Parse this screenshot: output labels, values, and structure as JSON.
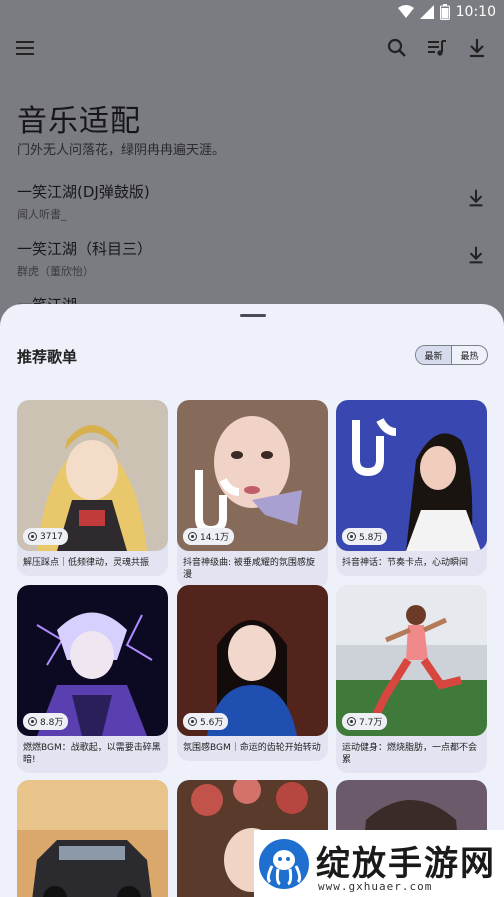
{
  "status_bar": {
    "time": "10:10",
    "battery": "87"
  },
  "page": {
    "title": "音乐适配",
    "subtitle": "门外无人问落花，绿阴冉冉遍天涯。"
  },
  "songs": [
    {
      "title": "一笑江湖(DJ弹鼓版)",
      "artist": "闻人听書_"
    },
    {
      "title": "一笑江湖（科目三）",
      "artist": "群虎（董欣怡）"
    },
    {
      "title": "一笑江湖",
      "artist": ""
    }
  ],
  "sheet": {
    "title": "推荐歌单",
    "toggle": [
      "最新",
      "最热"
    ],
    "cards": [
      {
        "plays": "3717",
        "caption": "解压踩点｜低频律动，灵魂共振"
      },
      {
        "plays": "14.1万",
        "caption": "抖音神级曲: 被垂咸耀的氛围感旋漫"
      },
      {
        "plays": "5.8万",
        "caption": "抖音神话：节奏卡点，心动瞬间"
      },
      {
        "plays": "8.8万",
        "caption": "燃燃BGM：战歌起，以需要击碎黑暗!"
      },
      {
        "plays": "5.6万",
        "caption": "氛围感BGM｜命运的齿轮开始转动"
      },
      {
        "plays": "7.7万",
        "caption": "运动健身：燃烧脂肪，一点都不会累"
      }
    ]
  },
  "watermark": {
    "title": "绽放手游网",
    "url": "www.gxhuaer.com"
  }
}
